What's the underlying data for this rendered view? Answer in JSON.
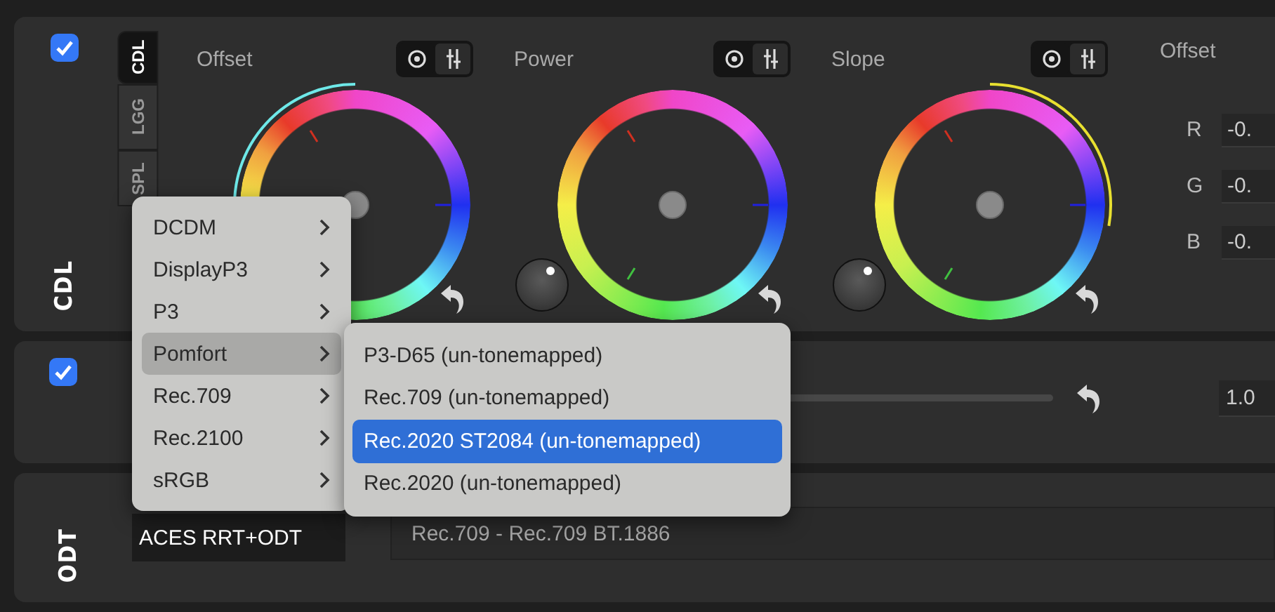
{
  "panels": [
    {
      "kind": "wheels",
      "label": "CDL",
      "enabled": true,
      "tabs": [
        {
          "label": "CDL",
          "selected": true
        },
        {
          "label": "LGG",
          "selected": false
        },
        {
          "label": "SPL",
          "selected": false
        }
      ],
      "wheels": [
        {
          "title": "Offset",
          "knob": false,
          "arc_left": true,
          "arc_right": false,
          "modes": [
            {
              "kind": "wheel",
              "selected": true
            },
            {
              "kind": "sliders",
              "selected": false
            }
          ]
        },
        {
          "title": "Power",
          "knob": true,
          "arc_left": false,
          "arc_right": false,
          "modes": [
            {
              "kind": "wheel",
              "selected": true
            },
            {
              "kind": "sliders",
              "selected": false
            }
          ]
        },
        {
          "title": "Slope",
          "knob": true,
          "arc_left": false,
          "arc_right": true,
          "modes": [
            {
              "kind": "wheel",
              "selected": true
            },
            {
              "kind": "sliders",
              "selected": false
            }
          ]
        }
      ],
      "values": {
        "title": "Offset",
        "rows": [
          {
            "channel": "R",
            "value": "-0."
          },
          {
            "channel": "G",
            "value": "-0."
          },
          {
            "channel": "B",
            "value": "-0."
          }
        ]
      }
    },
    {
      "kind": "slider",
      "enabled": true,
      "value": "1.0"
    },
    {
      "kind": "odt",
      "label": "ODT",
      "transform": "ACES RRT+ODT",
      "output": "Rec.709 - Rec.709 BT.1886"
    }
  ],
  "menu": {
    "items": [
      {
        "label": "DCDM",
        "selected": false
      },
      {
        "label": "DisplayP3",
        "selected": false
      },
      {
        "label": "P3",
        "selected": false
      },
      {
        "label": "Pomfort",
        "selected": true
      },
      {
        "label": "Rec.709",
        "selected": false
      },
      {
        "label": "Rec.2100",
        "selected": false
      },
      {
        "label": "sRGB",
        "selected": false
      }
    ],
    "submenu": [
      {
        "label": "P3-D65 (un-tonemapped)",
        "selected": false
      },
      {
        "label": "Rec.709 (un-tonemapped)",
        "selected": false
      },
      {
        "label": "Rec.2020 ST2084 (un-tonemapped)",
        "selected": true
      },
      {
        "label": "Rec.2020 (un-tonemapped)",
        "selected": false
      }
    ]
  }
}
